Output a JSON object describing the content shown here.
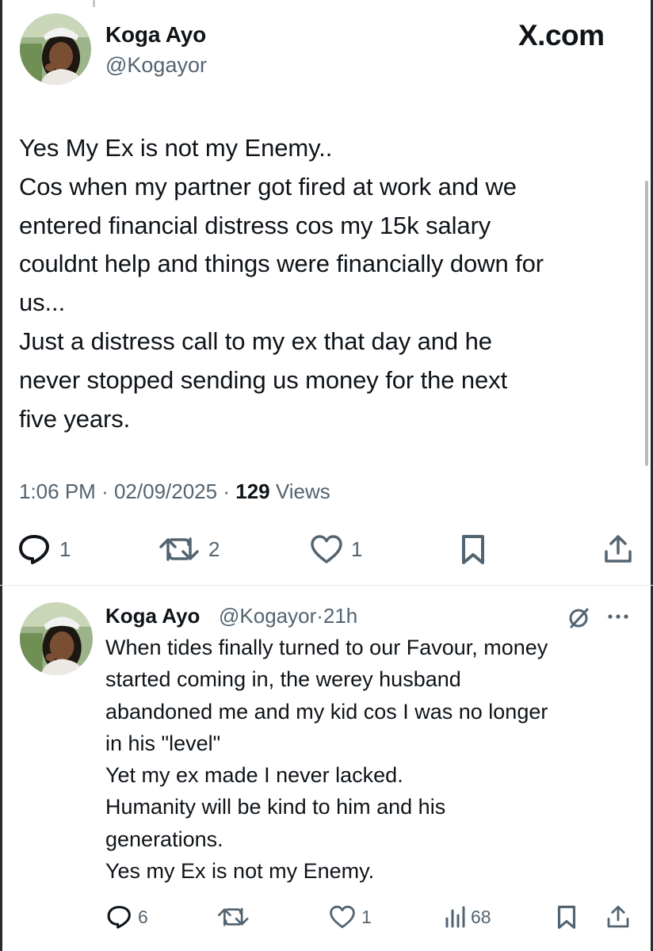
{
  "main_tweet": {
    "author_name": "Koga Ayo",
    "author_handle": "@Kogayor",
    "site_logo": "X.com",
    "body_lines": [
      "Yes My Ex is not my Enemy..",
      "Cos when my partner got fired at work and we",
      "entered financial distress cos my 15k salary",
      "couldnt help and things were financially down for",
      "us...",
      "Just a distress call to my ex that day and he",
      "never stopped sending us money for the next",
      "five years."
    ],
    "time": "1:06 PM",
    "date": "02/09/2025",
    "views_count": "129",
    "views_label": "Views",
    "separator": "·",
    "actions": {
      "reply_icon": "speech-bubble-icon",
      "reply_count": "1",
      "repost_icon": "repost-arrows-icon",
      "repost_count": "2",
      "like_icon": "heart-icon",
      "like_count": "1",
      "bookmark_icon": "bookmark-icon",
      "share_icon": "share-upload-icon"
    }
  },
  "reply_tweet": {
    "author_name": "Koga Ayo",
    "handle_time": "@Kogayor·21h",
    "menu_icon": "more-dots-icon",
    "status_icon": "slashed-circle-icon",
    "body_lines": [
      "When tides finally turned to our Favour, money",
      "started coming in, the werey husband",
      "abandoned me and my kid cos I was no longer",
      "in his \"level\"",
      "Yet my ex made I never lacked.",
      "Humanity will be kind to him and his",
      "generations.",
      "Yes my Ex is not my Enemy."
    ],
    "actions": {
      "reply_count": "6",
      "repost_count": "",
      "like_count": "1",
      "views_count": "68"
    }
  },
  "colors": {
    "text": "#0f1419",
    "secondary": "#536471",
    "divider": "#e6e9ec",
    "background": "#ffffff"
  }
}
